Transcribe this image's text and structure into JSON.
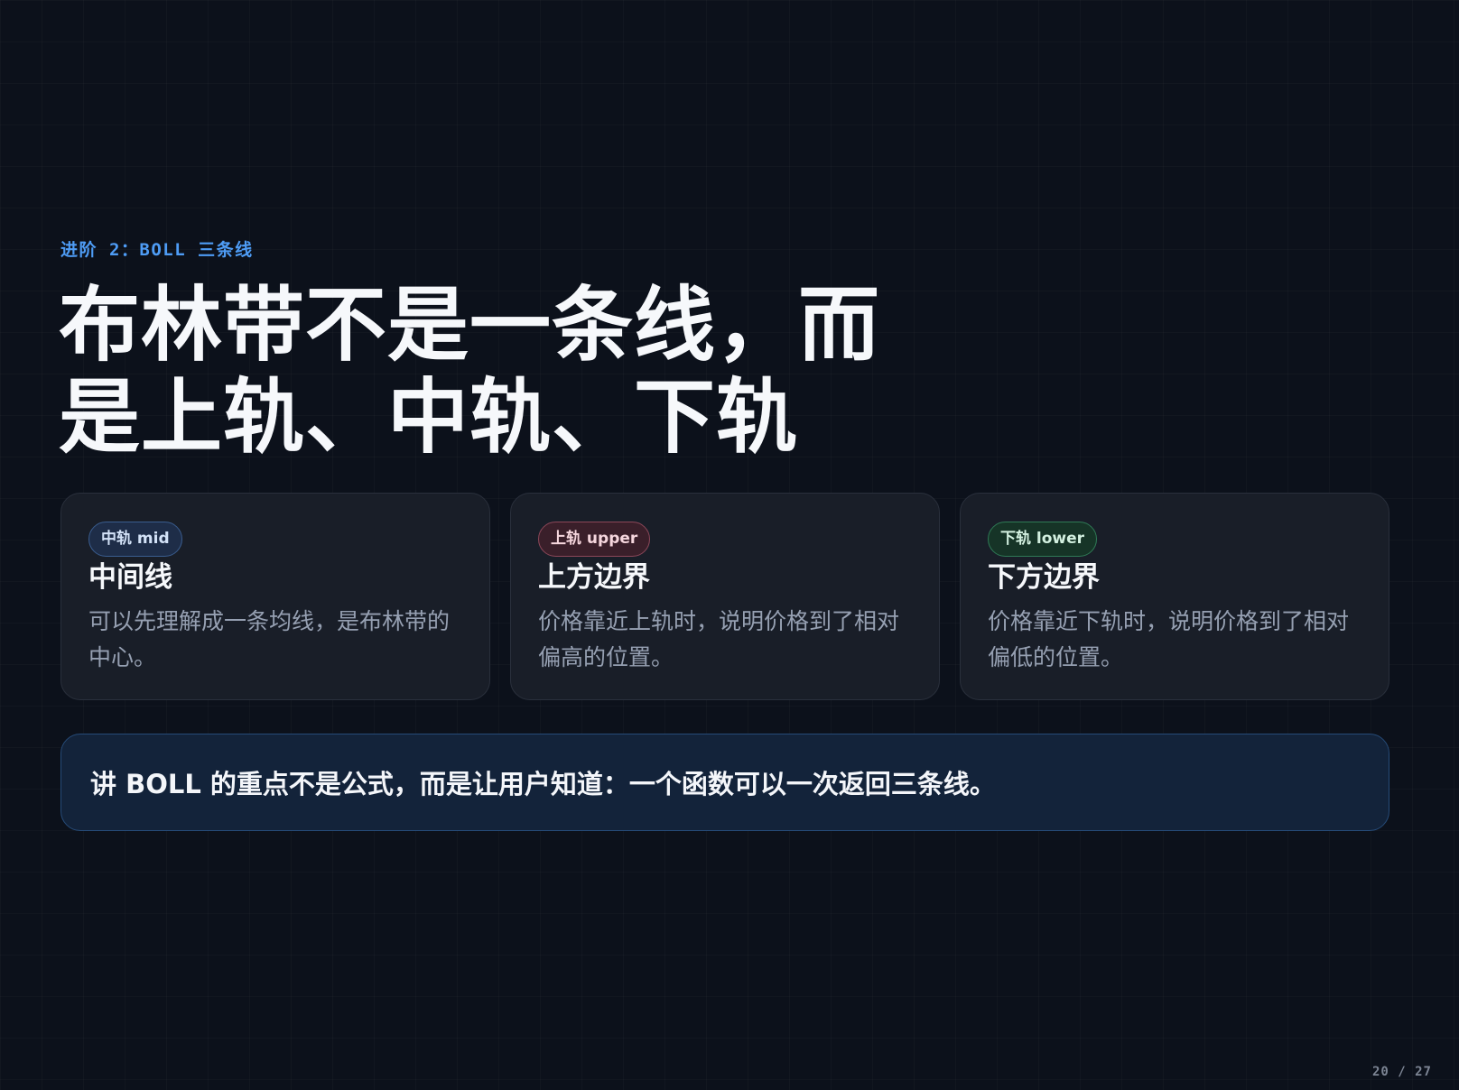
{
  "kicker": "进阶 2：BOLL 三条线",
  "headline": {
    "line1": "布林带不是一条线，而",
    "line2": "是上轨、中轨、下轨"
  },
  "cards": [
    {
      "badge": "中轨 mid",
      "title": "中间线",
      "description": "可以先理解成一条均线，是布林带的中心。",
      "badge_color": "#3a5d8f"
    },
    {
      "badge": "上轨 upper",
      "title": "上方边界",
      "description": "价格靠近上轨时，说明价格到了相对偏高的位置。",
      "badge_color": "#8c4759"
    },
    {
      "badge": "下轨 lower",
      "title": "下方边界",
      "description": "价格靠近下轨时，说明价格到了相对偏低的位置。",
      "badge_color": "#2f7a56"
    }
  ],
  "callout": "讲 BOLL 的重点不是公式，而是让用户知道：一个函数可以一次返回三条线。",
  "pagination": "20 / 27",
  "colors": {
    "background": "#0c111b",
    "accent": "#4e9cf5",
    "text": "#f6f8fb",
    "muted": "#96a0b2"
  }
}
